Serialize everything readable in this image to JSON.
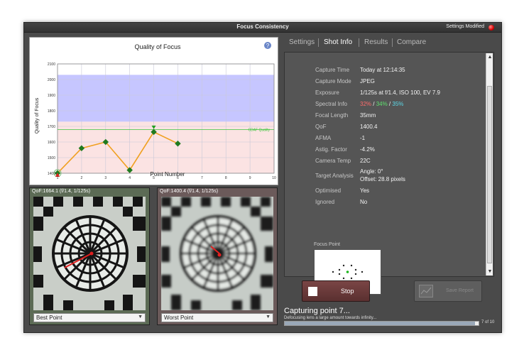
{
  "window": {
    "title": "Focus Consistency",
    "settings_status": "Settings Modified"
  },
  "chart_data": {
    "type": "line",
    "title": "Quality of Focus",
    "xlabel": "Point Number",
    "ylabel": "Quality of Focus",
    "xlim": [
      1,
      10
    ],
    "ylim": [
      1400,
      2100
    ],
    "x_ticks": [
      1,
      2,
      3,
      4,
      5,
      6,
      7,
      8,
      9,
      10
    ],
    "y_ticks": [
      1400,
      1500,
      1600,
      1700,
      1800,
      1900,
      2000,
      2100
    ],
    "grid": true,
    "series": [
      {
        "x": [
          1,
          2,
          3,
          4,
          5,
          6
        ],
        "values": [
          1400.4,
          1560,
          1600,
          1420,
          1664.1,
          1590
        ],
        "color": "#f0a020"
      }
    ],
    "cdaf_quality": {
      "label": "CDAF Quality",
      "value": 1680,
      "color": "#3cc63c"
    },
    "bands": [
      {
        "from": 1730,
        "to": 2030,
        "color": "#c6c6ff"
      },
      {
        "from": 1400,
        "to": 1730,
        "color": "#fbe3e3"
      }
    ],
    "best_point": 5,
    "worst_point": 1
  },
  "images": {
    "best": {
      "caption": "QoF:1664.1 (f/1.4, 1/125s)",
      "select_value": "Best Point"
    },
    "worst": {
      "caption": "QoF:1400.4 (f/1.4, 1/125s)",
      "select_value": "Worst Point"
    }
  },
  "tabs": [
    "Settings",
    "Shot Info",
    "Results",
    "Compare"
  ],
  "active_tab": "Shot Info",
  "shot_info": {
    "capture_time": {
      "label": "Capture Time",
      "value": "Today at 12:14:35"
    },
    "capture_mode": {
      "label": "Capture Mode",
      "value": "JPEG"
    },
    "exposure": {
      "label": "Exposure",
      "value": "1/125s at f/1.4, ISO 100, EV 7.9"
    },
    "spectral": {
      "label": "Spectral Info",
      "red": "32%",
      "sep1": " / ",
      "green": "34%",
      "sep2": " / ",
      "cyan": "35%"
    },
    "focal_length": {
      "label": "Focal Length",
      "value": "35mm"
    },
    "qof": {
      "label": "QoF",
      "value": "1400.4"
    },
    "afma": {
      "label": "AFMA",
      "value": "-1"
    },
    "astig": {
      "label": "Astig. Factor",
      "value": "-4.2%"
    },
    "camera_temp": {
      "label": "Camera Temp",
      "value": "22C"
    },
    "target_analysis": {
      "label": "Target Analysis",
      "angle": "Angle: 0°",
      "offset": "Offset: 28.8 pixels"
    },
    "optimised": {
      "label": "Optimised",
      "value": "Yes"
    },
    "ignored": {
      "label": "Ignored",
      "value": "No"
    },
    "focus_point_label": "Focus Point"
  },
  "buttons": {
    "stop": "Stop",
    "save_report": "Save Report"
  },
  "status": {
    "title": "Capturing point 7...",
    "subtitle": "Defocusing lens a large amount towards infinity...",
    "progress_fraction": 0.98,
    "count": "7 of 10"
  }
}
